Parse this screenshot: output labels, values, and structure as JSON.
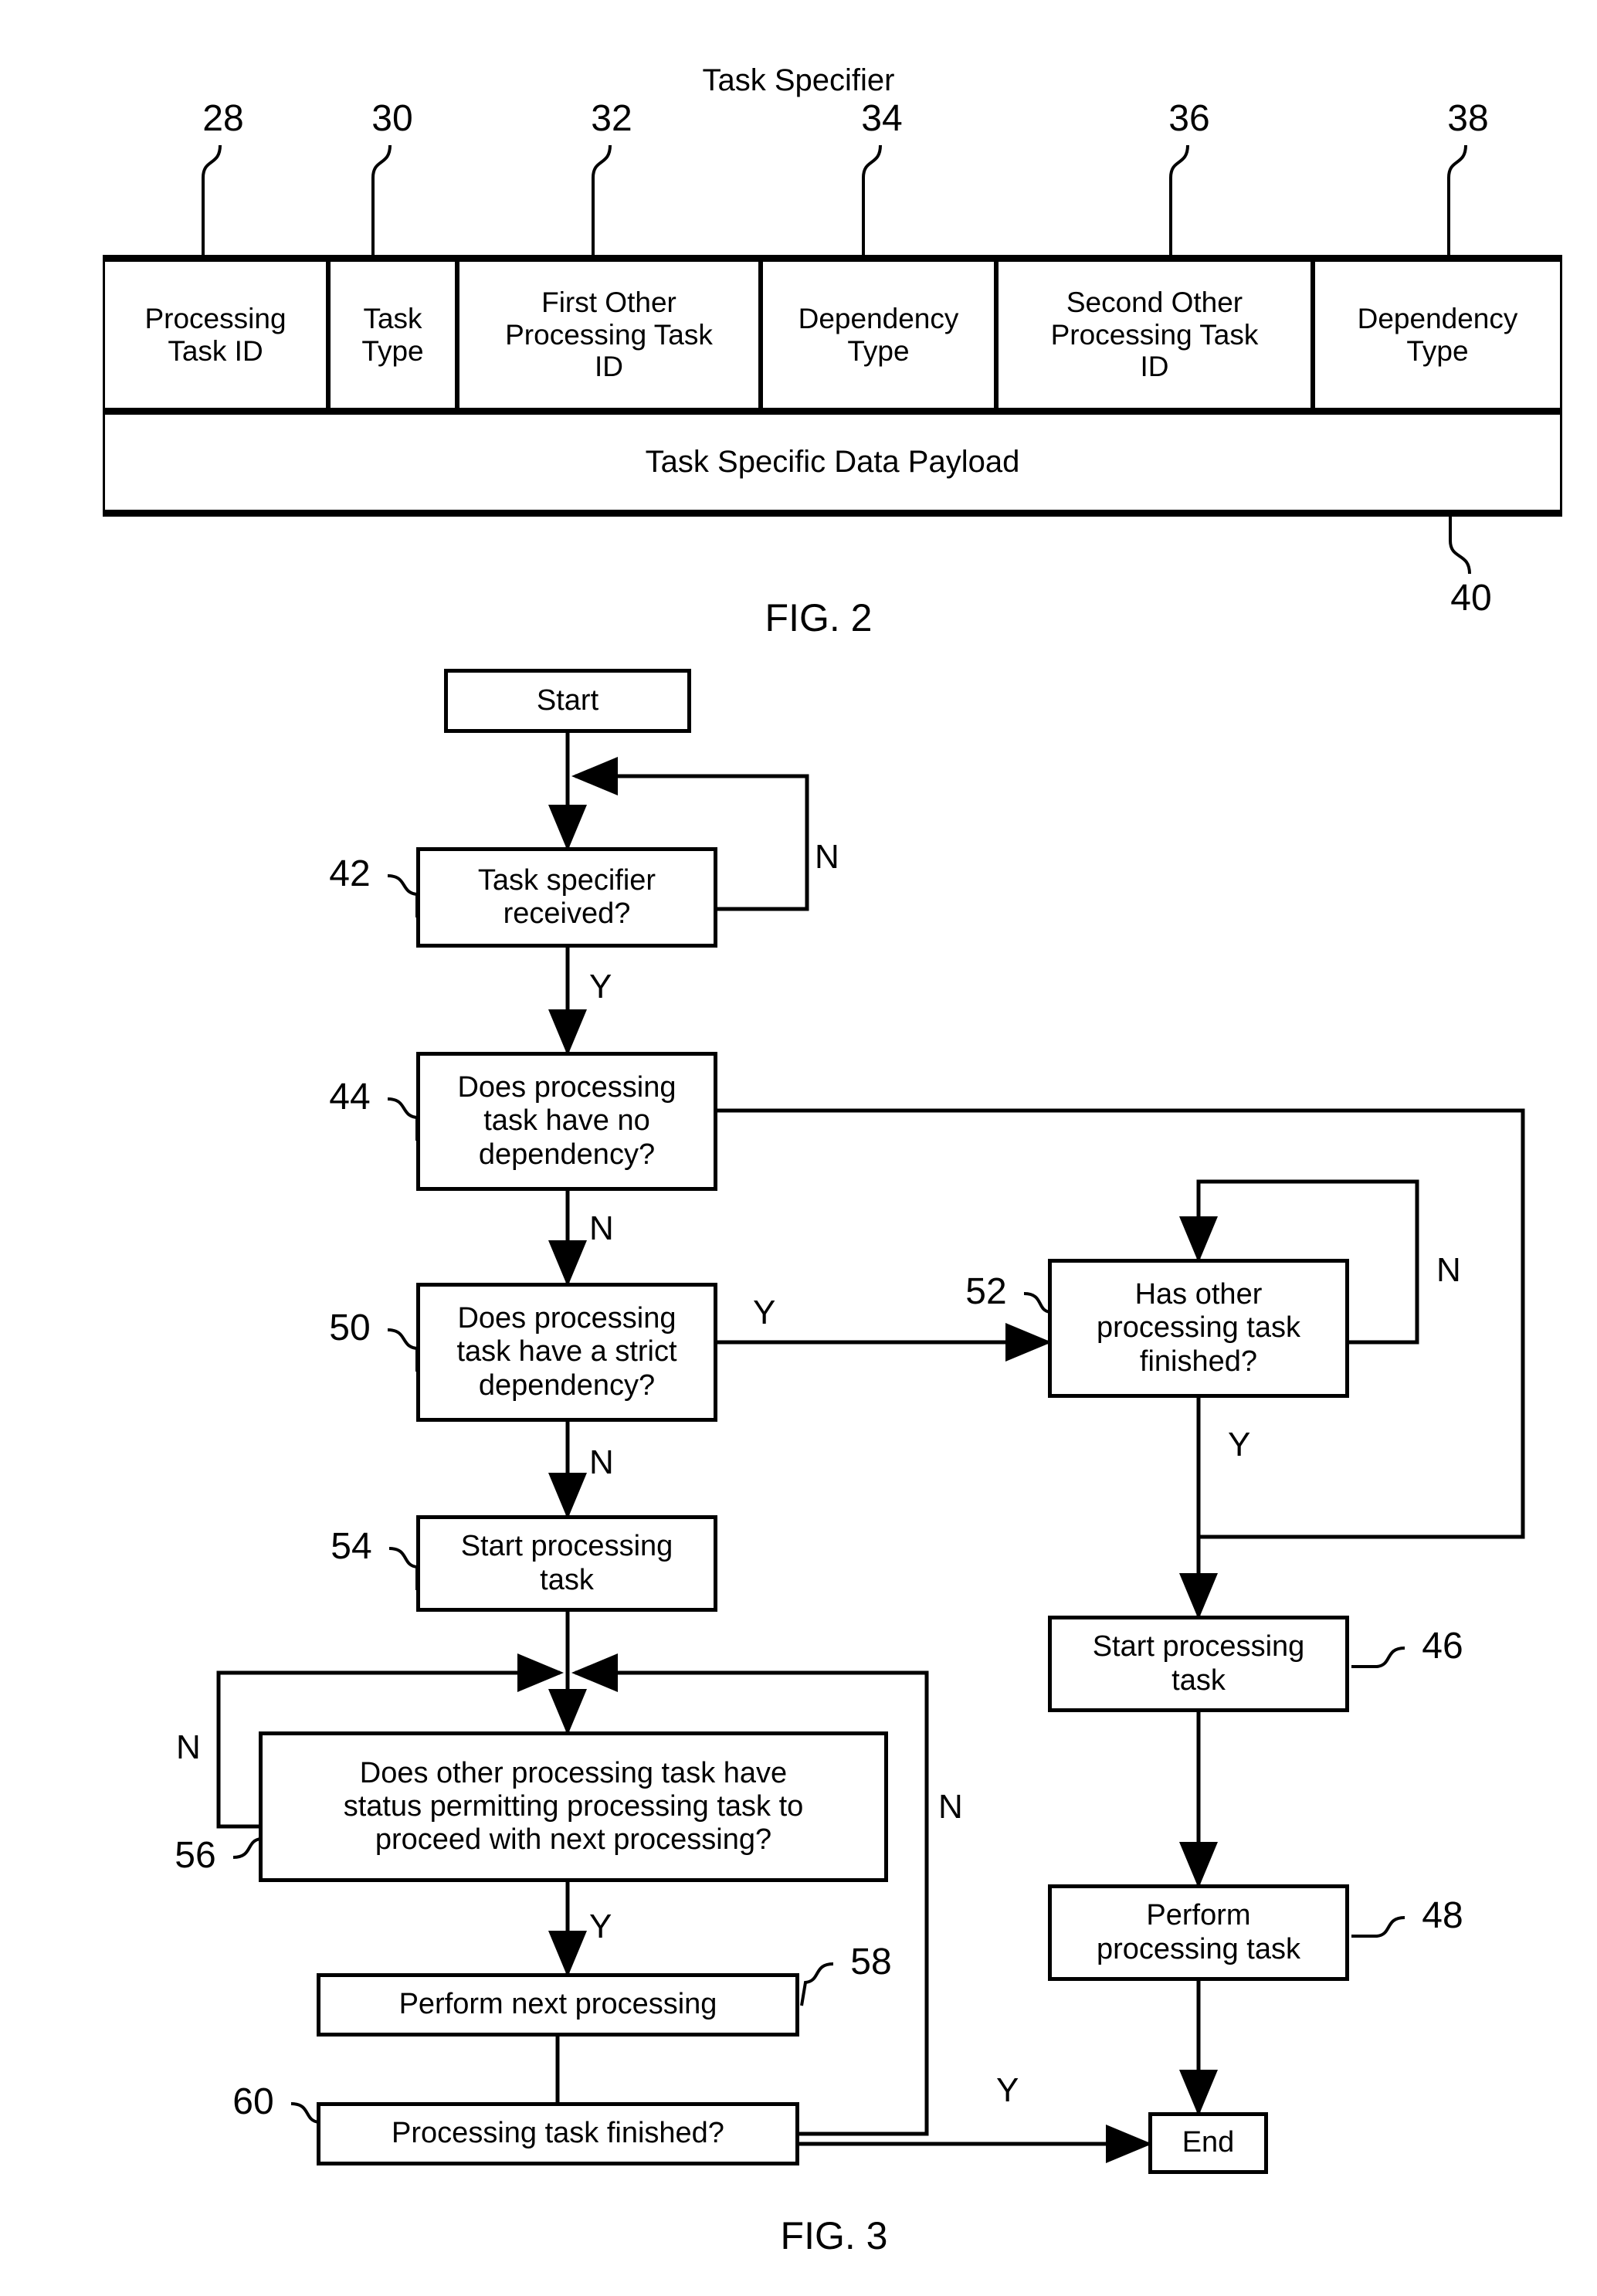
{
  "figure2": {
    "title": "Task Specifier",
    "fig_label": "FIG. 2",
    "payload_ref": "40",
    "fields": [
      {
        "ref": "28",
        "label": "Processing\nTask ID"
      },
      {
        "ref": "30",
        "label": "Task\nType"
      },
      {
        "ref": "32",
        "label": "First Other\nProcessing Task\nID"
      },
      {
        "ref": "34",
        "label": "Dependency\nType"
      },
      {
        "ref": "36",
        "label": "Second Other\nProcessing Task\nID"
      },
      {
        "ref": "38",
        "label": "Dependency\nType"
      }
    ],
    "payload": "Task Specific Data Payload"
  },
  "figure3": {
    "fig_label": "FIG. 3",
    "nodes": {
      "start": {
        "label": "Start"
      },
      "n42": {
        "ref": "42",
        "label": "Task specifier\nreceived?"
      },
      "n44": {
        "ref": "44",
        "label": "Does processing\ntask have no\ndependency?"
      },
      "n50": {
        "ref": "50",
        "label": "Does processing\ntask have a strict\ndependency?"
      },
      "n52": {
        "ref": "52",
        "label": "Has other\nprocessing task\nfinished?"
      },
      "n54": {
        "ref": "54",
        "label": "Start processing\ntask"
      },
      "n46": {
        "ref": "46",
        "label": "Start processing\ntask"
      },
      "n48": {
        "ref": "48",
        "label": "Perform\nprocessing task"
      },
      "n56": {
        "ref": "56",
        "label": "Does other processing task have\nstatus permitting processing task to\nproceed with next processing?"
      },
      "n58": {
        "ref": "58",
        "label": "Perform next processing"
      },
      "n60": {
        "ref": "60",
        "label": "Processing task finished?"
      },
      "end": {
        "label": "End"
      }
    },
    "edge_labels": {
      "e42_n": "N",
      "e42_y": "Y",
      "e44_n": "N",
      "e50_y": "Y",
      "e50_n": "N",
      "e52_n": "N",
      "e52_y": "Y",
      "e56_n": "N",
      "e56_y": "Y",
      "e60_n": "N",
      "e60_y": "Y"
    }
  }
}
